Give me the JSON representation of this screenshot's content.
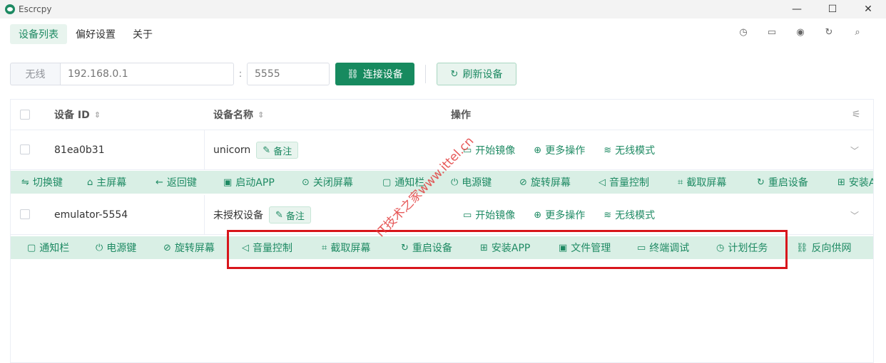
{
  "window": {
    "title": "Escrcpy",
    "controls": {
      "minimize": "—",
      "maximize": "☐",
      "close": "✕"
    }
  },
  "nav": {
    "tabs": [
      {
        "label": "设备列表",
        "active": true
      },
      {
        "label": "偏好设置",
        "active": false
      },
      {
        "label": "关于",
        "active": false
      }
    ],
    "icons": [
      "clock-icon",
      "terminal-icon",
      "eye-icon",
      "refresh-icon",
      "search-icon"
    ]
  },
  "connect": {
    "addon_label": "无线",
    "ip_placeholder": "192.168.0.1",
    "separator": ":",
    "port_placeholder": "5555",
    "connect_label": "连接设备",
    "refresh_label": "刷新设备"
  },
  "table": {
    "columns": {
      "device_id": "设备 ID",
      "device_name": "设备名称",
      "actions": "操作"
    },
    "rows": [
      {
        "id": "81ea0b31",
        "name": "unicorn",
        "note_label": "备注",
        "ops": [
          "开始镜像",
          "更多操作",
          "无线模式"
        ],
        "actions": [
          "切换键",
          "主屏幕",
          "返回键",
          "启动APP",
          "关闭屏幕",
          "通知栏",
          "电源键",
          "旋转屏幕",
          "音量控制",
          "截取屏幕",
          "重启设备",
          "安装APP"
        ]
      },
      {
        "id": "emulator-5554",
        "name": "未授权设备",
        "note_label": "备注",
        "ops": [
          "开始镜像",
          "更多操作",
          "无线模式"
        ],
        "actions": [
          "通知栏",
          "电源键",
          "旋转屏幕",
          "音量控制",
          "截取屏幕",
          "重启设备",
          "安装APP",
          "文件管理",
          "终端调试",
          "计划任务",
          "反向供网"
        ]
      }
    ]
  },
  "watermark": "IT技术之家www.ittel.cn",
  "colors": {
    "accent": "#1e8a63",
    "primary_button": "#178a5f",
    "action_bar_bg": "#d9efe5",
    "highlight": "#d8161c"
  }
}
